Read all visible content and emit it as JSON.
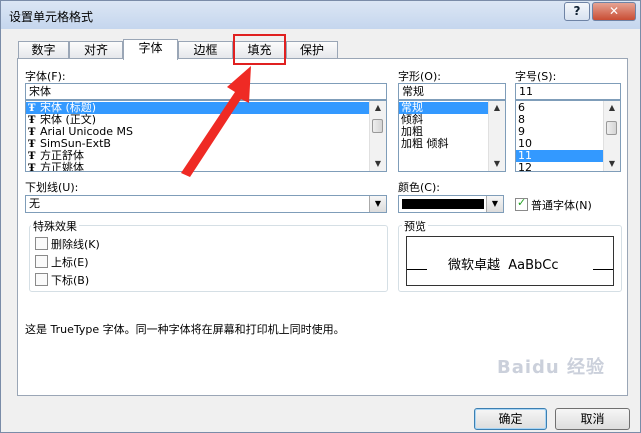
{
  "window": {
    "title": "设置单元格格式",
    "help": "?",
    "close": "✕"
  },
  "tabs": [
    "数字",
    "对齐",
    "字体",
    "边框",
    "填充",
    "保护"
  ],
  "font": {
    "label": "字体(F):",
    "value": "宋体",
    "items": [
      "宋体 (标题)",
      "宋体 (正文)",
      "Arial Unicode MS",
      "SimSun-ExtB",
      "方正舒体",
      "方正姚体"
    ],
    "selected_index": 0,
    "type_glyph": "Ŧ"
  },
  "style": {
    "label": "字形(O):",
    "value": "常规",
    "items": [
      "常规",
      "倾斜",
      "加粗",
      "加粗 倾斜"
    ],
    "selected_index": 0
  },
  "size": {
    "label": "字号(S):",
    "value": "11",
    "items": [
      "6",
      "8",
      "9",
      "10",
      "11",
      "12"
    ],
    "selected_index": 4
  },
  "underline": {
    "label": "下划线(U):",
    "value": "无"
  },
  "color": {
    "label": "颜色(C):",
    "swatch": "#000000",
    "normal_font_label": "普通字体(N)",
    "normal_font_checked": true
  },
  "effects": {
    "label": "特殊效果",
    "strikethrough": "删除线(K)",
    "superscript": "上标(E)",
    "subscript": "下标(B)"
  },
  "preview": {
    "label": "预览",
    "text": "微软卓越  AaBbCc"
  },
  "info": "这是 TrueType 字体。同一种字体将在屏幕和打印机上同时使用。",
  "buttons": {
    "ok": "确定",
    "cancel": "取消"
  },
  "watermark": "Baidu 经验",
  "colors": {
    "highlight": "#e02020",
    "selection": "#3399ff"
  }
}
